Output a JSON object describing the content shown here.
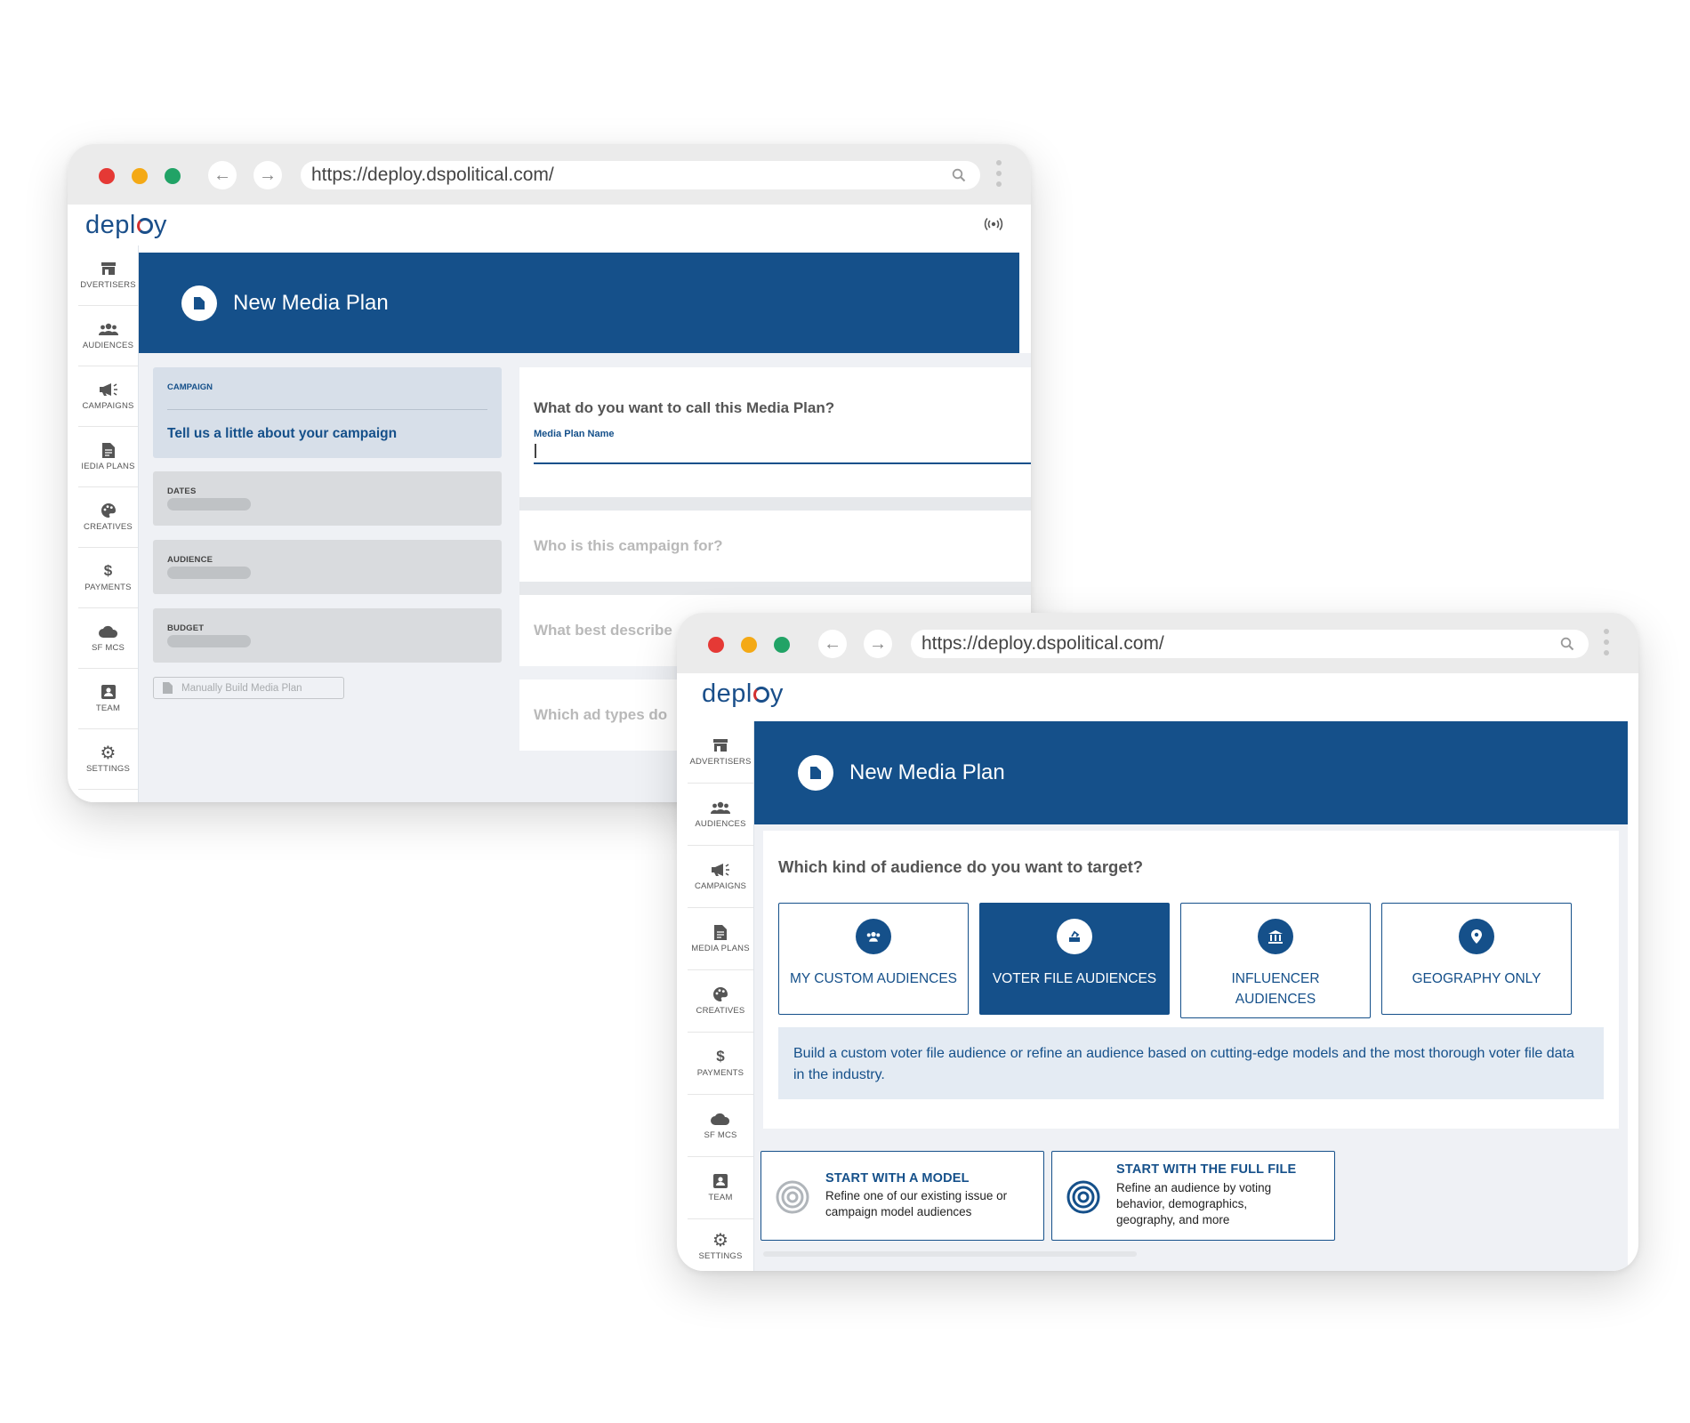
{
  "window_back": {
    "url": "https://deploy.dspolitical.com/",
    "logo": {
      "text_before": "depl",
      "text_after": "y"
    },
    "sidebar": [
      {
        "label": "DVERTISERS",
        "icon": "storefront-icon"
      },
      {
        "label": "AUDIENCES",
        "icon": "people-icon"
      },
      {
        "label": "CAMPAIGNS",
        "icon": "megaphone-icon"
      },
      {
        "label": "IEDIA PLANS",
        "icon": "document-icon"
      },
      {
        "label": "CREATIVES",
        "icon": "palette-icon"
      },
      {
        "label": "PAYMENTS",
        "icon": "dollar-icon"
      },
      {
        "label": "SF MCS",
        "icon": "cloud-icon"
      },
      {
        "label": "TEAM",
        "icon": "id-card-icon"
      },
      {
        "label": "SETTINGS",
        "icon": "gear-icon"
      }
    ],
    "banner_title": "New Media Plan",
    "steps": {
      "campaign_label": "CAMPAIGN",
      "campaign_prompt": "Tell us a little about your campaign",
      "dates_label": "DATES",
      "audience_label": "AUDIENCE",
      "budget_label": "BUDGET"
    },
    "manual_build_label": "Manually Build Media Plan",
    "questions": {
      "q1": "What do you want to call this Media Plan?",
      "field_label": "Media Plan Name",
      "field_value": "",
      "q2": "Who is this campaign for?",
      "q3": "What best describe",
      "q4": "Which ad types do"
    }
  },
  "window_front": {
    "url": "https://deploy.dspolitical.com/",
    "logo": {
      "text_before": "depl",
      "text_after": "y"
    },
    "sidebar": [
      {
        "label": "ADVERTISERS",
        "icon": "storefront-icon"
      },
      {
        "label": "AUDIENCES",
        "icon": "people-icon"
      },
      {
        "label": "CAMPAIGNS",
        "icon": "megaphone-icon"
      },
      {
        "label": "MEDIA PLANS",
        "icon": "document-icon"
      },
      {
        "label": "CREATIVES",
        "icon": "palette-icon"
      },
      {
        "label": "PAYMENTS",
        "icon": "dollar-icon"
      },
      {
        "label": "SF MCS",
        "icon": "cloud-icon"
      },
      {
        "label": "TEAM",
        "icon": "id-card-icon"
      },
      {
        "label": "SETTINGS",
        "icon": "gear-icon"
      }
    ],
    "banner_title": "New Media Plan",
    "question": "Which kind of audience do you want to target?",
    "audience_options": [
      {
        "label": "MY CUSTOM AUDIENCES",
        "icon": "people-icon",
        "selected": false
      },
      {
        "label": "VOTER FILE AUDIENCES",
        "icon": "ballot-icon",
        "selected": true
      },
      {
        "label": "INFLUENCER AUDIENCES",
        "icon": "institution-icon",
        "selected": false
      },
      {
        "label": "GEOGRAPHY ONLY",
        "icon": "map-pin-icon",
        "selected": false
      }
    ],
    "info_text": "Build a custom voter file audience or refine an audience based on cutting-edge models and the most thorough voter file data in the industry.",
    "start_options": [
      {
        "title": "START WITH A MODEL",
        "desc": "Refine one of our existing issue or campaign model audiences",
        "icon": "concentric-circles-icon"
      },
      {
        "title": "START WITH THE FULL FILE",
        "desc": "Refine an audience by voting behavior, demographics, geography, and more",
        "icon": "target-icon"
      }
    ]
  },
  "colors": {
    "brand_blue": "#15508a",
    "dot_red": "#e53935",
    "dot_yellow": "#f4a915",
    "dot_green": "#21a366"
  }
}
